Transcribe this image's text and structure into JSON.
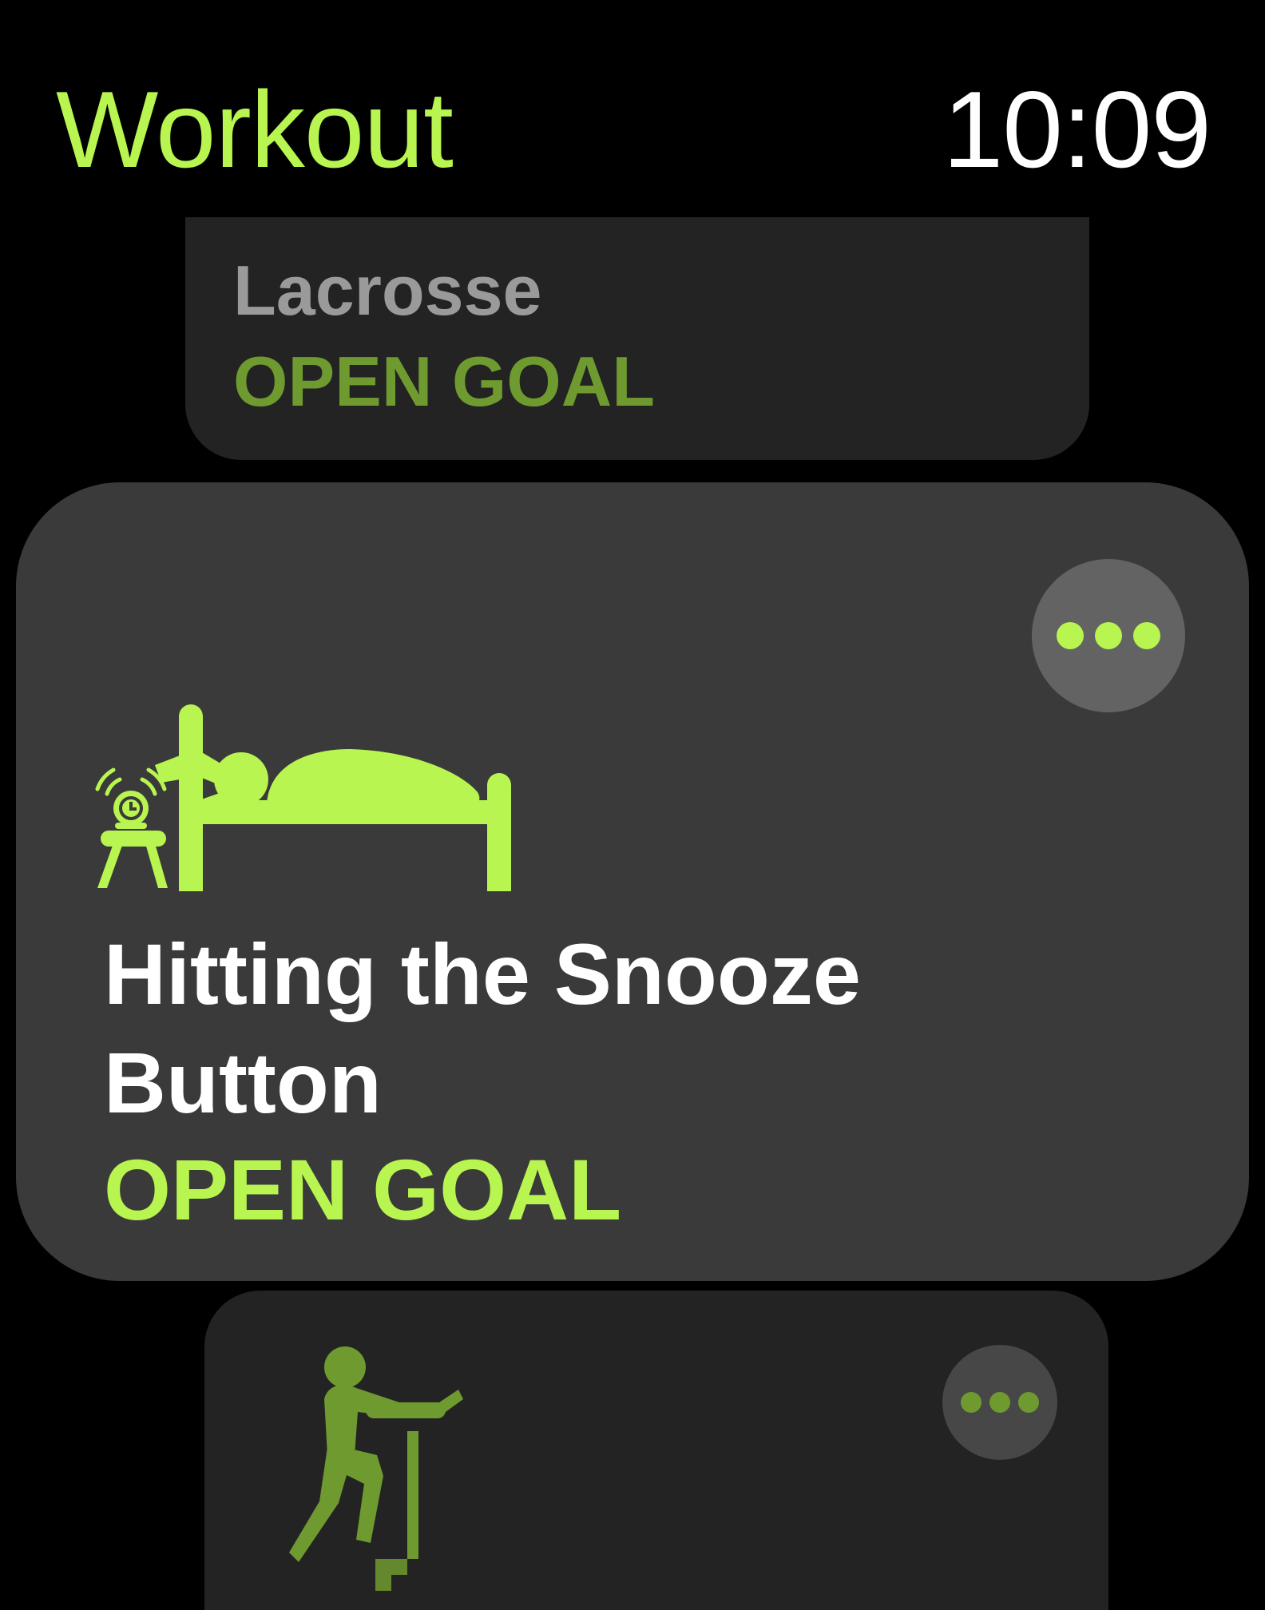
{
  "header": {
    "app_title": "Workout",
    "time": "10:09"
  },
  "workouts": [
    {
      "name": "Lacrosse",
      "goal": "OPEN GOAL"
    },
    {
      "name": "Hitting the Snooze Button",
      "goal": "OPEN GOAL",
      "icon": "sleeping-in-bed-with-alarm-clock-icon",
      "more_icon": "ellipsis-icon"
    },
    {
      "icon": "stair-stepper-icon",
      "more_icon": "ellipsis-icon"
    }
  ],
  "colors": {
    "accent": "#b8f550",
    "accent_dim": "#6e9a30",
    "card_focused": "#3a3a3a",
    "card_dim": "#232323",
    "background": "#000000"
  }
}
